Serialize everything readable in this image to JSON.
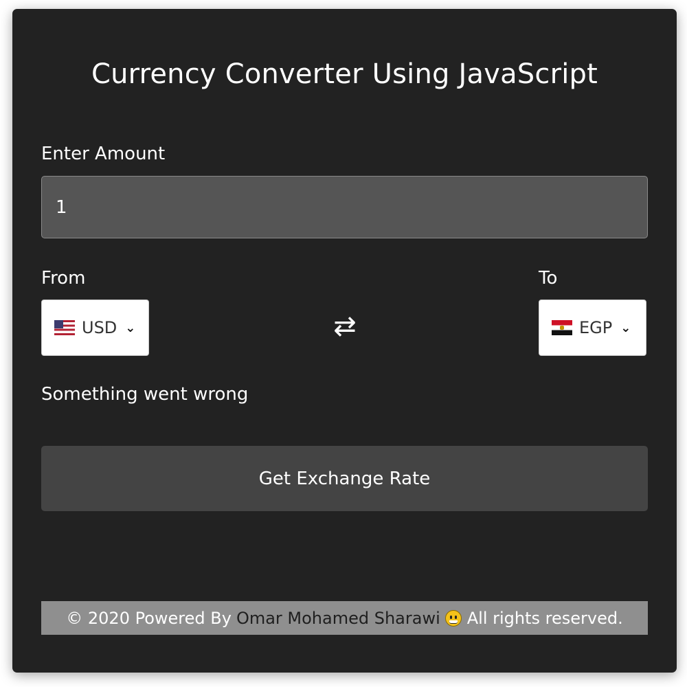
{
  "app": {
    "title": "Currency Converter Using JavaScript"
  },
  "amount": {
    "label": "Enter Amount",
    "value": "1"
  },
  "from": {
    "label": "From",
    "selected_code": "USD",
    "flag_icon": "us-flag-icon"
  },
  "to": {
    "label": "To",
    "selected_code": "EGP",
    "flag_icon": "egypt-flag-icon"
  },
  "swap": {
    "icon": "swap-arrows-icon"
  },
  "status": {
    "message": "Something went wrong"
  },
  "button": {
    "label": "Get Exchange Rate"
  },
  "footer": {
    "prefix": "© 2020 Powered By",
    "author": "Omar Mohamed Sharawi",
    "suffix": "All rights reserved.",
    "emoji_icon": "grinning-face-icon"
  },
  "colors": {
    "card_background": "#222222",
    "input_background": "#555555",
    "button_background": "#444444",
    "footer_background": "#8f8f8f",
    "text": "#ffffff"
  }
}
